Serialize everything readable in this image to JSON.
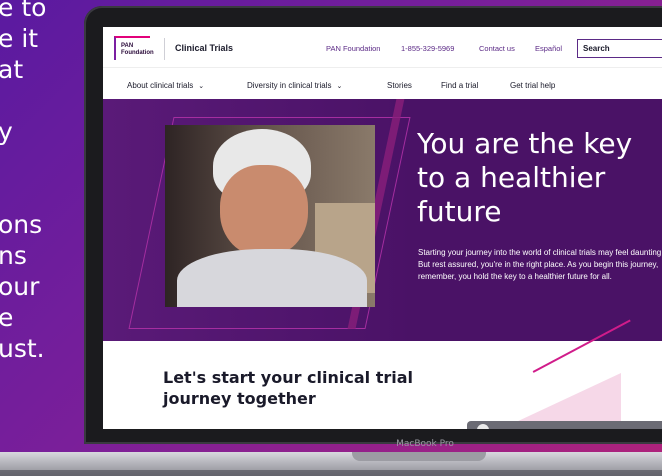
{
  "left_panel": {
    "lines_a": [
      "e to",
      "e it",
      "at"
    ],
    "lines_b": [
      "y"
    ],
    "lines_c": [
      "ons",
      "ns",
      "our",
      "e",
      "ust."
    ]
  },
  "device": {
    "label": "MacBook Pro"
  },
  "header": {
    "logo_text": "PAN\nFoundation",
    "site_title": "Clinical Trials",
    "util_links": [
      "PAN Foundation",
      "1-855-329-5969",
      "Contact us",
      "Español"
    ],
    "search_text": "Search"
  },
  "nav": {
    "items": [
      {
        "label": "About clinical trials",
        "has_chevron": true
      },
      {
        "label": "Diversity in clinical trials",
        "has_chevron": true
      },
      {
        "label": "Stories",
        "has_chevron": false
      },
      {
        "label": "Find a trial",
        "has_chevron": false
      },
      {
        "label": "Get trial help",
        "has_chevron": false
      }
    ]
  },
  "hero": {
    "title_lines": [
      "You are the key",
      "to a healthier",
      "future"
    ],
    "body": "Starting your journey into the world of clinical trials may feel daunting. But rest assured, you're in the right place. As you begin this journey, remember, you hold the key to a healthier future for all."
  },
  "section": {
    "title_lines": [
      "Let's start your clinical trial",
      "journey together"
    ]
  },
  "colors": {
    "background_gradient": [
      "#5a1aa0",
      "#b0227a"
    ],
    "hero_bg": "#4a1266",
    "accent": "#e2007a",
    "brand_purple": "#5b2a86"
  }
}
